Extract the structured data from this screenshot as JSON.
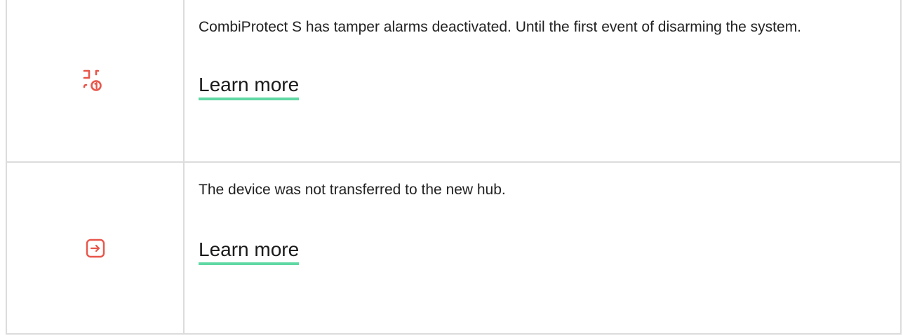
{
  "colors": {
    "icon_red": "#e8564a",
    "link_underline": "#5fd8a3",
    "border": "#dcdcdc"
  },
  "rows": [
    {
      "icon": "tamper-alarm-disabled-icon",
      "description": "CombiProtect S has tamper alarms deactivated. Until the first event of disarming the system.",
      "link_label": "Learn more"
    },
    {
      "icon": "device-transfer-icon",
      "description": "The device was not transferred to the new hub.",
      "link_label": "Learn more"
    }
  ]
}
